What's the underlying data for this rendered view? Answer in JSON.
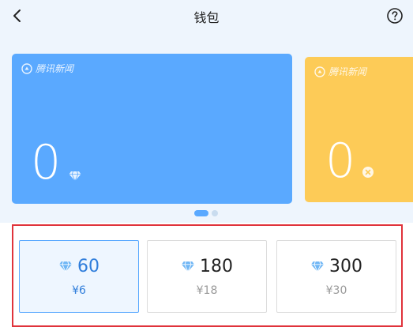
{
  "header": {
    "title": "钱包",
    "back_icon": "chevron-left-icon",
    "help_icon": "question-circle-icon"
  },
  "cards": [
    {
      "brand": "腾讯新闻",
      "balance": "0",
      "currency_icon": "diamond-icon",
      "color": "#5aa9ff"
    },
    {
      "brand": "腾讯新闻",
      "balance": "0",
      "currency_icon": "coin-icon",
      "color": "#fdcb57"
    }
  ],
  "carousel": {
    "total_pages": 2,
    "active_page": 1
  },
  "recharge_options": [
    {
      "amount": "60",
      "price": "¥6",
      "selected": true
    },
    {
      "amount": "180",
      "price": "¥18",
      "selected": false
    },
    {
      "amount": "300",
      "price": "¥30",
      "selected": false
    }
  ],
  "colors": {
    "accent": "#5aa9ff",
    "highlight_border": "#e0333b",
    "background": "#eef5fd"
  }
}
